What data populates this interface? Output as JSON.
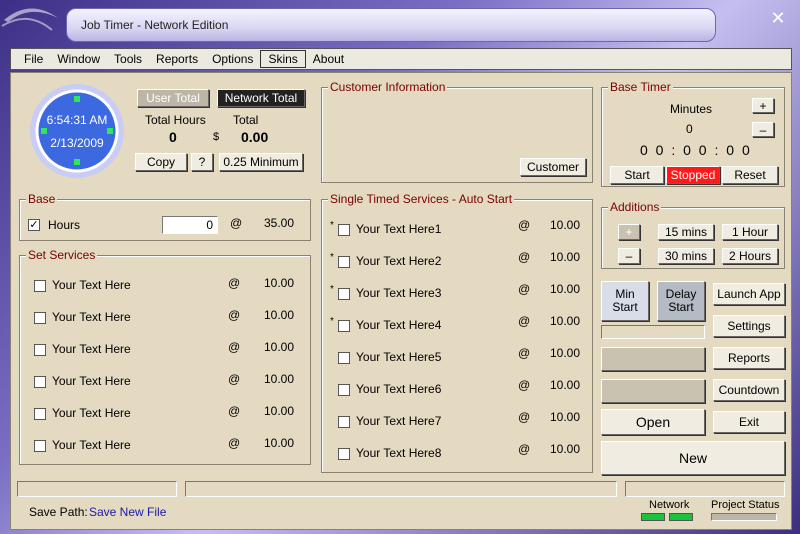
{
  "window": {
    "title": "Job Timer - Network Edition",
    "close": "✕"
  },
  "menu": [
    {
      "label": "File"
    },
    {
      "label": "Window"
    },
    {
      "label": "Tools"
    },
    {
      "label": "Reports"
    },
    {
      "label": "Options"
    },
    {
      "label": "Skins",
      "active": true
    },
    {
      "label": "About"
    }
  ],
  "clock": {
    "time": "6:54:31 AM",
    "date": "2/13/2009"
  },
  "totals": {
    "user_total": "User Total",
    "network_total": "Network Total",
    "total_hours_label": "Total Hours",
    "total_label": "Total",
    "hours_value": "0",
    "currency": "$",
    "total_value": "0.00",
    "copy": "Copy",
    "help": "?",
    "minimum": "0.25 Minimum"
  },
  "customer": {
    "title": "Customer Information",
    "button": "Customer"
  },
  "base_timer": {
    "title": "Base Timer",
    "minutes_label": "Minutes",
    "minutes_value": "0",
    "plus": "+",
    "minus": "–",
    "timer": "0 0 : 0 0 : 0 0",
    "start": "Start",
    "status": "Stopped",
    "reset": "Reset"
  },
  "base": {
    "title": "Base",
    "label": "Hours",
    "checked": true,
    "value": "0",
    "at": "@",
    "rate": "35.00"
  },
  "set_services": {
    "title": "Set Services",
    "items": [
      {
        "label": "Your Text Here",
        "at": "@",
        "rate": "10.00"
      },
      {
        "label": "Your Text Here",
        "at": "@",
        "rate": "10.00"
      },
      {
        "label": "Your Text Here",
        "at": "@",
        "rate": "10.00"
      },
      {
        "label": "Your Text Here",
        "at": "@",
        "rate": "10.00"
      },
      {
        "label": "Your Text Here",
        "at": "@",
        "rate": "10.00"
      },
      {
        "label": "Your Text Here",
        "at": "@",
        "rate": "10.00"
      }
    ]
  },
  "single_services": {
    "title": "Single Timed Services - Auto Start",
    "items": [
      {
        "label": "Your Text Here1",
        "star": "*",
        "at": "@",
        "rate": "10.00"
      },
      {
        "label": "Your Text Here2",
        "star": "*",
        "at": "@",
        "rate": "10.00"
      },
      {
        "label": "Your Text Here3",
        "star": "*",
        "at": "@",
        "rate": "10.00"
      },
      {
        "label": "Your Text Here4",
        "star": "*",
        "at": "@",
        "rate": "10.00"
      },
      {
        "label": "Your Text Here5",
        "star": "",
        "at": "@",
        "rate": "10.00"
      },
      {
        "label": "Your Text Here6",
        "star": "",
        "at": "@",
        "rate": "10.00"
      },
      {
        "label": "Your Text Here7",
        "star": "",
        "at": "@",
        "rate": "10.00"
      },
      {
        "label": "Your Text Here8",
        "star": "",
        "at": "@",
        "rate": "10.00"
      }
    ]
  },
  "additions": {
    "title": "Additions",
    "plus": "+",
    "minus": "–",
    "b15": "15 mins",
    "b1h": "1 Hour",
    "b30": "30 mins",
    "b2h": "2 Hours"
  },
  "actions": {
    "min_start": "Min Start",
    "delay_start": "Delay Start",
    "launch_app": "Launch App",
    "settings": "Settings",
    "reports": "Reports",
    "countdown": "Countdown",
    "open": "Open",
    "exit": "Exit",
    "new": "New"
  },
  "footer": {
    "save_path_label": "Save Path:",
    "save_path_link": "Save New File",
    "network_label": "Network",
    "project_status_label": "Project Status"
  },
  "colors": {
    "title_accent": "#7a0000",
    "stopped": "#ff1a1a",
    "link": "#1a1aa8",
    "led_on": "#19c43c"
  }
}
